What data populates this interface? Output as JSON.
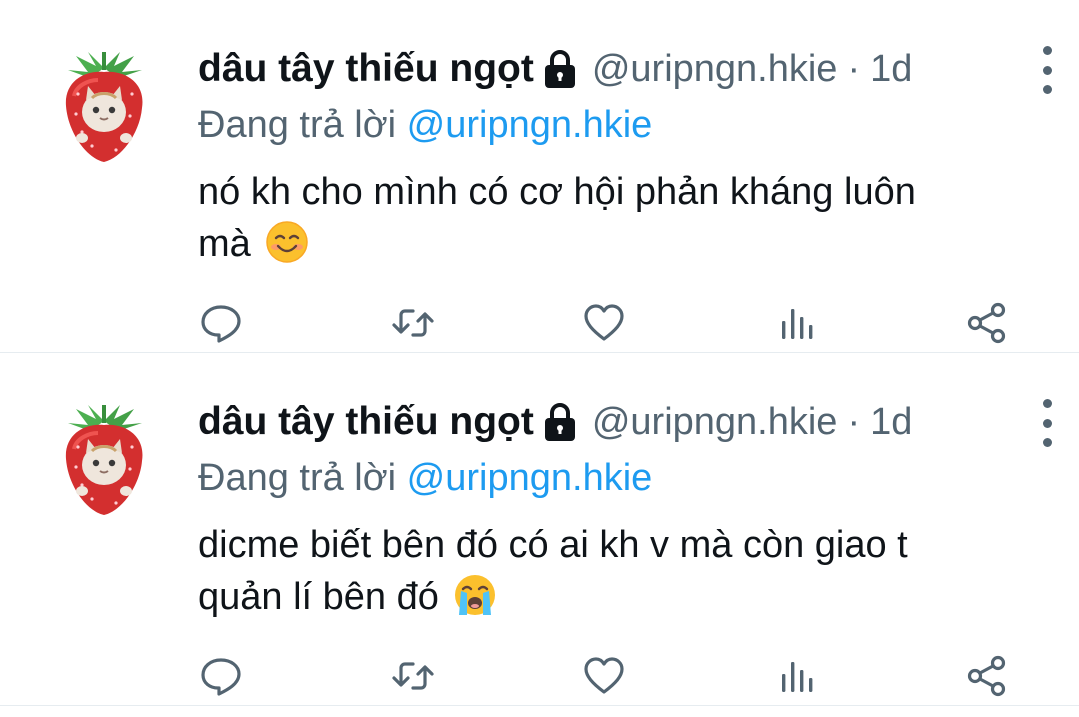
{
  "tweets": [
    {
      "name": "dâu tây thiếu ngọt",
      "handle": "@uripngn.hkie",
      "separator": "·",
      "time": "1d",
      "reply_prefix": "Đang trả lời",
      "reply_mention": "@uripngn.hkie",
      "text_line1": "nó kh cho mình có cơ hội phản kháng luôn",
      "text_line2": "mà",
      "emoji": "smiling-face-icon"
    },
    {
      "name": "dâu tây thiếu ngọt",
      "handle": "@uripngn.hkie",
      "separator": "·",
      "time": "1d",
      "reply_prefix": "Đang trả lời",
      "reply_mention": "@uripngn.hkie",
      "text_line1": "dicme biết bên đó có ai kh v mà còn giao t",
      "text_line2": "quản lí bên đó",
      "emoji": "loudly-crying-face-icon"
    }
  ],
  "colors": {
    "text": "#0f1419",
    "secondary": "#536471",
    "link": "#1d9bf0",
    "divider": "#e6ecf0"
  },
  "action_icons": [
    "reply-icon",
    "retweet-icon",
    "like-icon",
    "analytics-icon",
    "share-icon"
  ]
}
